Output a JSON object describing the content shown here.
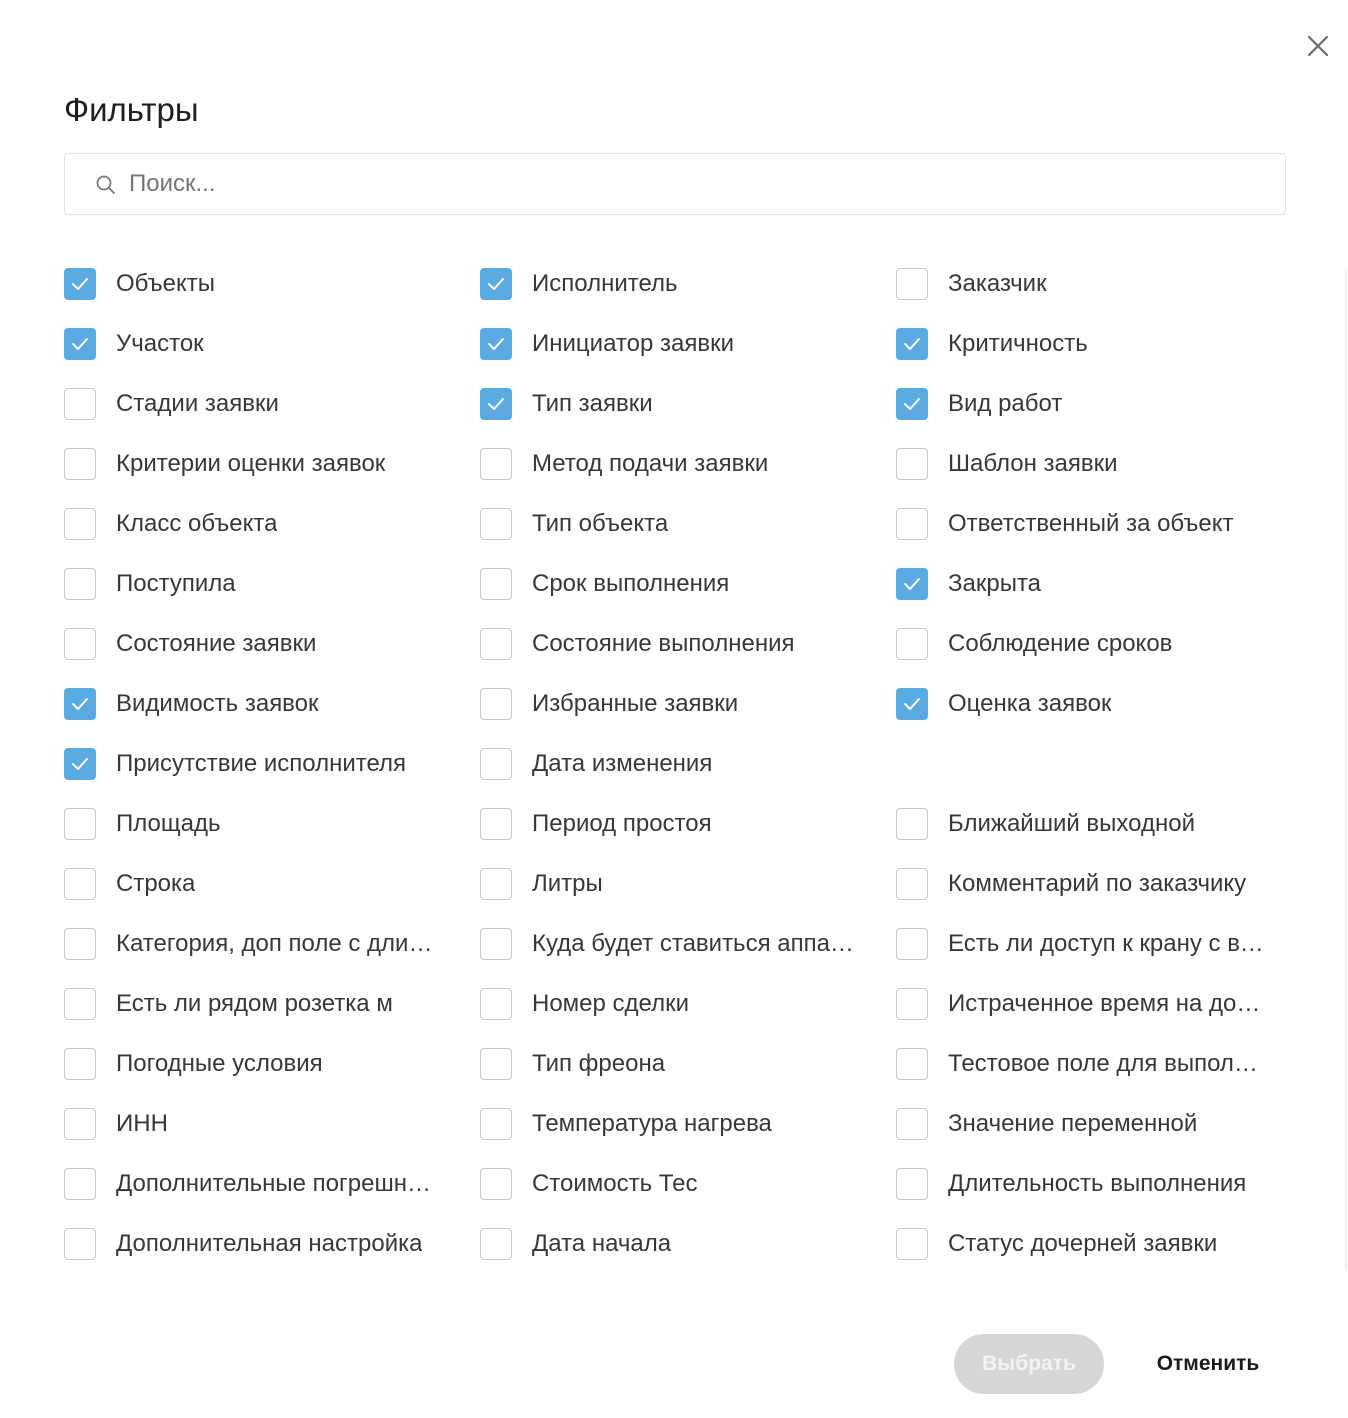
{
  "dialog": {
    "title": "Фильтры",
    "search": {
      "placeholder": "Поиск...",
      "value": ""
    },
    "buttons": {
      "select_label": "Выбрать",
      "cancel_label": "Отменить"
    }
  },
  "colors": {
    "accent": "#5aabe2",
    "checkbox_border": "#c9c9c9",
    "disabled_button": "#d6d6d6"
  },
  "icons": {
    "close": "close-icon",
    "search": "search-icon",
    "check": "check-icon"
  },
  "filters": [
    {
      "label": "Объекты",
      "checked": true
    },
    {
      "label": "Исполнитель",
      "checked": true
    },
    {
      "label": "Заказчик",
      "checked": false
    },
    {
      "label": "Участок",
      "checked": true
    },
    {
      "label": "Инициатор заявки",
      "checked": true
    },
    {
      "label": "Критичность",
      "checked": true
    },
    {
      "label": "Стадии заявки",
      "checked": false
    },
    {
      "label": "Тип заявки",
      "checked": true
    },
    {
      "label": "Вид работ",
      "checked": true
    },
    {
      "label": "Критерии оценки заявок",
      "checked": false
    },
    {
      "label": "Метод подачи заявки",
      "checked": false
    },
    {
      "label": "Шаблон заявки",
      "checked": false
    },
    {
      "label": "Класс объекта",
      "checked": false
    },
    {
      "label": "Тип объекта",
      "checked": false
    },
    {
      "label": "Ответственный за объект",
      "checked": false
    },
    {
      "label": "Поступила",
      "checked": false
    },
    {
      "label": "Срок выполнения",
      "checked": false
    },
    {
      "label": "Закрыта",
      "checked": true
    },
    {
      "label": "Состояние заявки",
      "checked": false
    },
    {
      "label": "Состояние выполнения",
      "checked": false
    },
    {
      "label": "Соблюдение сроков",
      "checked": false
    },
    {
      "label": "Видимость заявок",
      "checked": true
    },
    {
      "label": "Избранные заявки",
      "checked": false
    },
    {
      "label": "Оценка заявок",
      "checked": true
    },
    {
      "label": "Присутствие исполнителя",
      "checked": true
    },
    {
      "label": "Дата изменения",
      "checked": false
    },
    null,
    {
      "label": "Площадь",
      "checked": false
    },
    {
      "label": "Период простоя",
      "checked": false
    },
    {
      "label": "Ближайший выходной",
      "checked": false
    },
    {
      "label": "Строка",
      "checked": false
    },
    {
      "label": "Литры",
      "checked": false
    },
    {
      "label": "Комментарий по заказчику",
      "checked": false
    },
    {
      "label": "Категория, доп поле с длинным названием",
      "checked": false
    },
    {
      "label": "Куда будет ставиться аппарат",
      "checked": false
    },
    {
      "label": "Есть ли доступ к крану с водой",
      "checked": false
    },
    {
      "label": "Есть ли рядом розетка м",
      "checked": false
    },
    {
      "label": "Номер сделки",
      "checked": false
    },
    {
      "label": "Истраченное время на дорогу",
      "checked": false
    },
    {
      "label": "Погодные условия",
      "checked": false
    },
    {
      "label": "Тип фреона",
      "checked": false
    },
    {
      "label": "Тестовое поле для выполнения",
      "checked": false
    },
    {
      "label": "ИНН",
      "checked": false
    },
    {
      "label": "Температура нагрева",
      "checked": false
    },
    {
      "label": "Значение переменной",
      "checked": false
    },
    {
      "label": "Дополнительные погрешности",
      "checked": false
    },
    {
      "label": "Стоимость Тес",
      "checked": false
    },
    {
      "label": "Длительность выполнения",
      "checked": false
    },
    {
      "label": "Дополнительная настройка",
      "checked": false
    },
    {
      "label": "Дата начала",
      "checked": false
    },
    {
      "label": "Статус дочерней заявки",
      "checked": false
    }
  ]
}
